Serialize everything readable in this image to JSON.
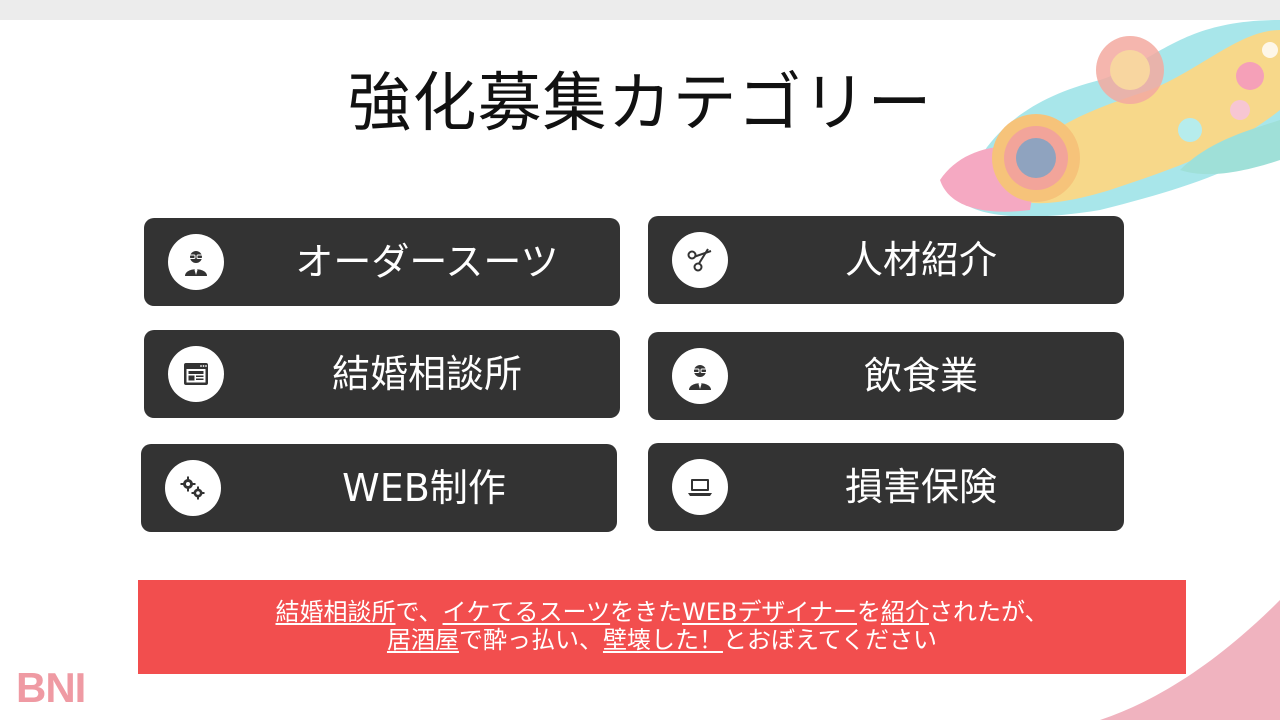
{
  "slide": {
    "title": "強化募集カテゴリー",
    "categories": [
      {
        "label": "オーダースーツ",
        "icon": "person-icon"
      },
      {
        "label": "人材紹介",
        "icon": "scissors-icon"
      },
      {
        "label": "結婚相談所",
        "icon": "browser-window-icon"
      },
      {
        "label": "飲食業",
        "icon": "person-icon"
      },
      {
        "label": "WEB制作",
        "icon": "gears-icon"
      },
      {
        "label": "損害保険",
        "icon": "laptop-icon"
      }
    ],
    "banner": {
      "line1": [
        {
          "text": "結婚相談所",
          "underline": true
        },
        {
          "text": "で、",
          "underline": false
        },
        {
          "text": "イケてるスーツ",
          "underline": true
        },
        {
          "text": "をきた",
          "underline": false
        },
        {
          "text": "WEBデザイナー",
          "underline": true
        },
        {
          "text": "を",
          "underline": false
        },
        {
          "text": "紹介",
          "underline": true
        },
        {
          "text": "されたが、",
          "underline": false
        }
      ],
      "line2": [
        {
          "text": "居酒屋",
          "underline": true
        },
        {
          "text": "で酔っ払い、",
          "underline": false
        },
        {
          "text": "壁壊した！",
          "underline": true
        },
        {
          "text": "とおぼえてください",
          "underline": false
        }
      ]
    },
    "logo": "BNI"
  },
  "colors": {
    "card_bg": "#333333",
    "banner_bg": "#f24e4e",
    "logo": "#ef9aa3"
  }
}
